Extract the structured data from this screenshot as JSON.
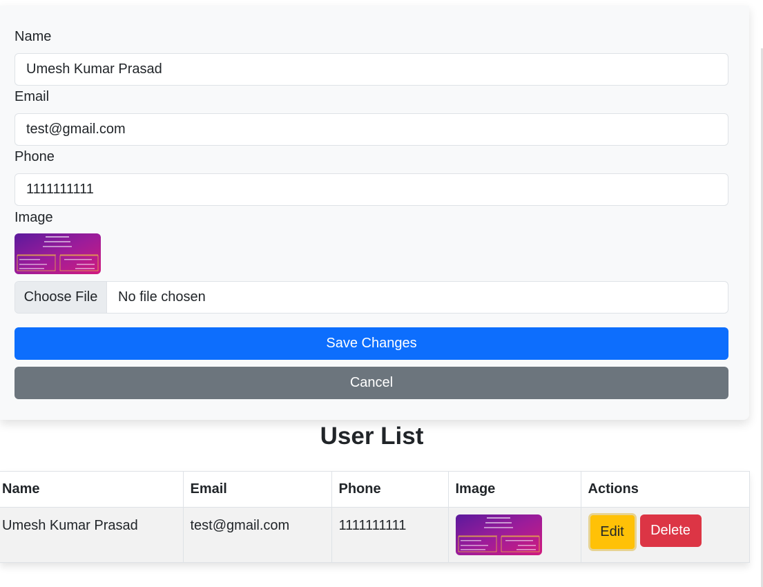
{
  "form": {
    "name_label": "Name",
    "name_value": "Umesh Kumar Prasad",
    "email_label": "Email",
    "email_value": "test@gmail.com",
    "phone_label": "Phone",
    "phone_value": "1111111111",
    "image_label": "Image",
    "choose_file_label": "Choose File",
    "file_status": "No file chosen",
    "save_label": "Save Changes",
    "cancel_label": "Cancel"
  },
  "user_list": {
    "title": "User List",
    "columns": [
      "Name",
      "Email",
      "Phone",
      "Image",
      "Actions"
    ],
    "rows": [
      {
        "name": "Umesh Kumar Prasad",
        "email": "test@gmail.com",
        "phone": "1111111111",
        "edit_label": "Edit",
        "delete_label": "Delete"
      }
    ]
  },
  "colors": {
    "primary": "#0d6efd",
    "secondary": "#6c757d",
    "warning": "#ffc107",
    "danger": "#dc3545",
    "panel_bg": "#f8f9fa"
  }
}
